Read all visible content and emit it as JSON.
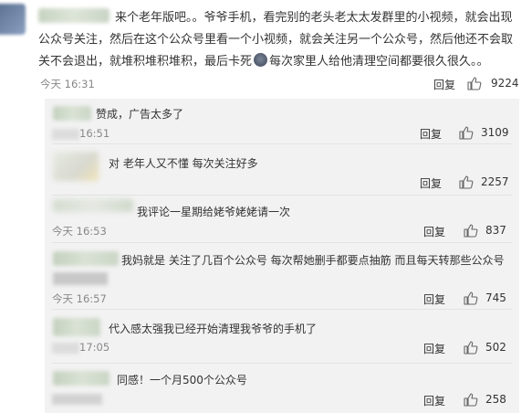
{
  "main_comment": {
    "text": "来个老年版吧。。爷爷手机，看完别的老头老太太发群里的小视频，就会出现公众号关注，然后在这个公众号里看一个小视频，就会关注另一个公众号，然后他还不会取关不会退出，就堆积堆积堆积，最后卡死",
    "text_after_avatar": "每次家里人给他清理空间都要很久很久。。",
    "time": "今天 16:31",
    "reply_label": "回复",
    "likes": "9224"
  },
  "replies": [
    {
      "text": "赞成，广告太多了",
      "time": "16:51",
      "reply_label": "回复",
      "likes": "3109"
    },
    {
      "text": "对 老年人又不懂 每次关注好多",
      "time": "",
      "reply_label": "回复",
      "likes": "2257"
    },
    {
      "text": "我评论一星期给姥爷姥姥请一次",
      "time": "今天 16:53",
      "reply_label": "回复",
      "likes": "837"
    },
    {
      "text": "我妈就是 关注了几百个公众号 每次帮她删手都要点抽筋 而且每天转那些公众号",
      "time": "今天 16:57",
      "reply_label": "回复",
      "likes": "745"
    },
    {
      "text": "代入感太强我已经开始清理我爷爷的手机了",
      "time": "17:05",
      "reply_label": "回复",
      "likes": "502"
    },
    {
      "text": "同感！一个月500个公众号",
      "time": "",
      "reply_label": "回复",
      "likes": "258"
    }
  ],
  "colors": {
    "panel_bg": "#f2f2f2",
    "text": "#333333",
    "muted": "#888888",
    "divider": "#e3e3e3"
  },
  "icons": {
    "like": "thumbs-up-icon"
  }
}
